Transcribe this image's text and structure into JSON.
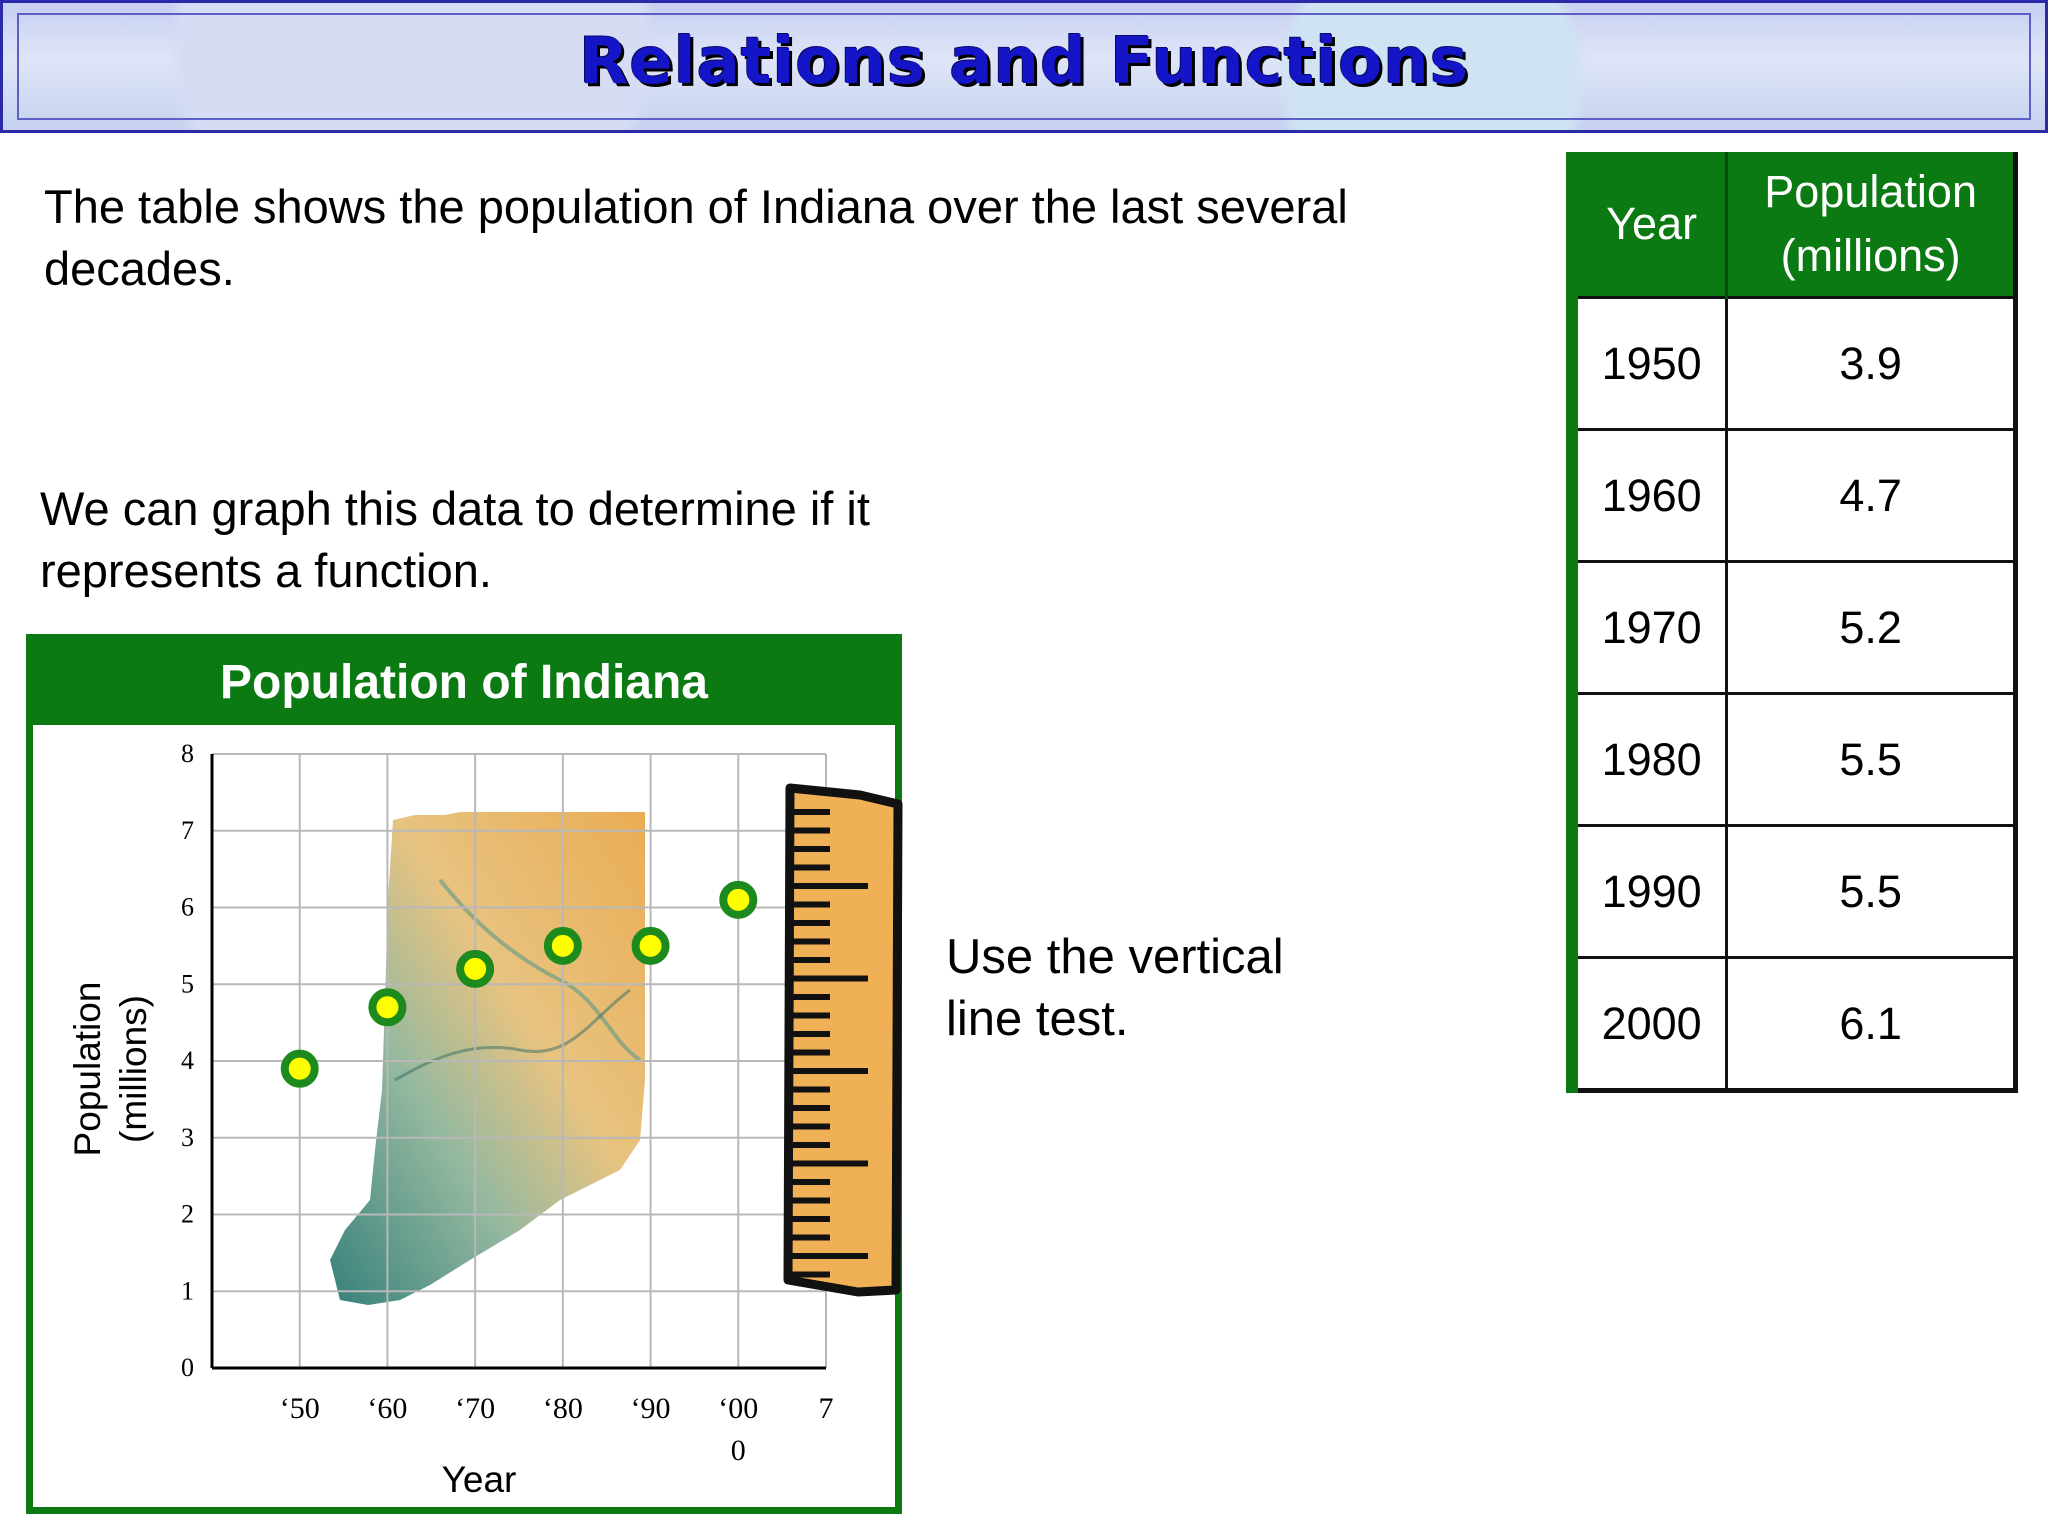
{
  "slide": {
    "title": "Relations and Functions",
    "intro_text": "The table shows the population of Indiana over the last several decades.",
    "graph_text": "We can graph this data to determine if it represents a function.",
    "vertical_line_text": "Use the vertical line test."
  },
  "table": {
    "headers": {
      "year": "Year",
      "population_line1": "Population",
      "population_line2": "(millions)"
    },
    "rows": [
      {
        "year": "1950",
        "population": "3.9"
      },
      {
        "year": "1960",
        "population": "4.7"
      },
      {
        "year": "1970",
        "population": "5.2"
      },
      {
        "year": "1980",
        "population": "5.5"
      },
      {
        "year": "1990",
        "population": "5.5"
      },
      {
        "year": "2000",
        "population": "6.1"
      }
    ]
  },
  "colors": {
    "banner_title": "#1515c8",
    "green": "#0b7a12",
    "point_fill": "#ffff00",
    "point_ring": "#1c8a1c",
    "ruler": "#f0b055"
  },
  "icons": {
    "ruler": "ruler-icon",
    "map": "indiana-map-icon"
  },
  "chart_data": {
    "type": "scatter",
    "title": "Population of Indiana",
    "xlabel": "Year",
    "ylabel_line1": "Population",
    "ylabel_line2": "(millions)",
    "x_tick_labels": [
      "‘50",
      "‘60",
      "‘70",
      "‘80",
      "‘90",
      "‘00",
      "7"
    ],
    "x_tick_sublabel": "0",
    "y_ticks": [
      "0",
      "1",
      "2",
      "3",
      "4",
      "5",
      "6",
      "7",
      "8"
    ],
    "ylim": [
      0,
      8
    ],
    "grid": true,
    "x": [
      "1950",
      "1960",
      "1970",
      "1980",
      "1990",
      "2000"
    ],
    "y": [
      3.9,
      4.7,
      5.2,
      5.5,
      5.5,
      6.1
    ]
  }
}
